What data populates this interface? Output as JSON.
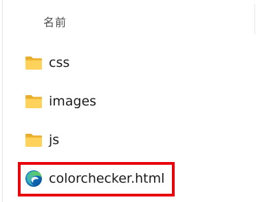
{
  "header": {
    "name_column": "名前"
  },
  "items": [
    {
      "label": "css",
      "type": "folder",
      "icon": "folder-icon"
    },
    {
      "label": "images",
      "type": "folder",
      "icon": "folder-icon"
    },
    {
      "label": "js",
      "type": "folder",
      "icon": "folder-icon"
    },
    {
      "label": "colorchecker.html",
      "type": "html-file",
      "icon": "edge-browser-icon"
    }
  ],
  "colors": {
    "folder": "#f6c744",
    "folder_front": "#ffd767",
    "highlight_border": "#e8000b",
    "edge_blue": "#0c59a4",
    "edge_green": "#5fd14a"
  }
}
